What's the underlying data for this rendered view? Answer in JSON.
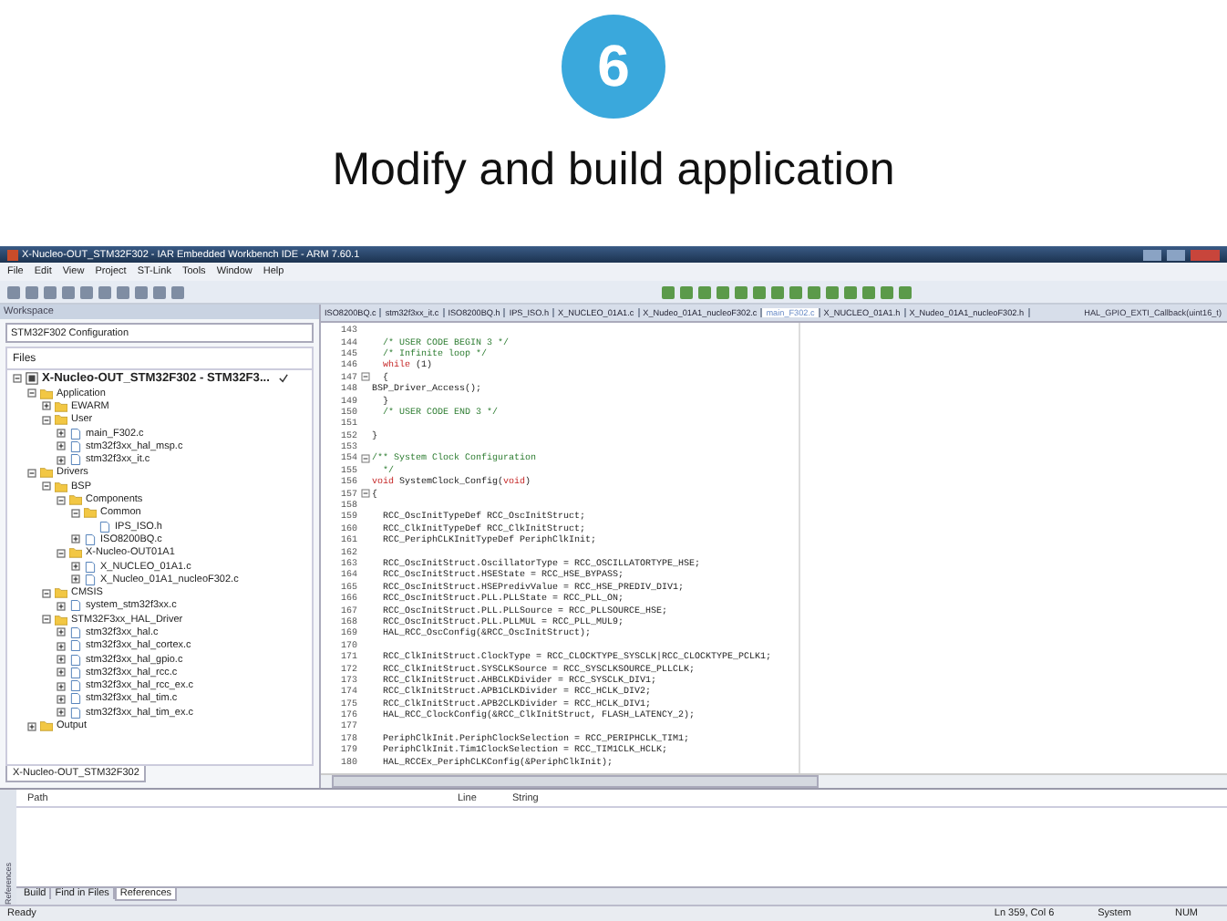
{
  "slide": {
    "step": "6",
    "title": "Modify and build application"
  },
  "window": {
    "title": "X-Nucleo-OUT_STM32F302 - IAR Embedded Workbench IDE - ARM 7.60.1"
  },
  "menu": [
    "File",
    "Edit",
    "View",
    "Project",
    "ST-Link",
    "Tools",
    "Window",
    "Help"
  ],
  "workspace": {
    "title": "Workspace",
    "configuration": "STM32F302 Configuration",
    "files_header": "Files",
    "tree": [
      {
        "label": "X-Nucleo-OUT_STM32F302 - STM32F3...",
        "kind": "project",
        "expanded": true,
        "children": [
          {
            "label": "Application",
            "kind": "folder",
            "expanded": true,
            "children": [
              {
                "label": "EWARM",
                "kind": "folder",
                "expanded": false
              },
              {
                "label": "User",
                "kind": "folder",
                "expanded": true,
                "children": [
                  {
                    "label": "main_F302.c",
                    "kind": "file",
                    "expanded": false
                  },
                  {
                    "label": "stm32f3xx_hal_msp.c",
                    "kind": "file",
                    "expanded": false
                  },
                  {
                    "label": "stm32f3xx_it.c",
                    "kind": "file",
                    "expanded": false
                  }
                ]
              }
            ]
          },
          {
            "label": "Drivers",
            "kind": "folder",
            "expanded": true,
            "children": [
              {
                "label": "BSP",
                "kind": "folder",
                "expanded": true,
                "children": [
                  {
                    "label": "Components",
                    "kind": "folder",
                    "expanded": true,
                    "children": [
                      {
                        "label": "Common",
                        "kind": "folder",
                        "expanded": true,
                        "children": [
                          {
                            "label": "IPS_ISO.h",
                            "kind": "file"
                          }
                        ]
                      },
                      {
                        "label": "ISO8200BQ.c",
                        "kind": "file",
                        "expanded": false
                      }
                    ]
                  },
                  {
                    "label": "X-Nucleo-OUT01A1",
                    "kind": "folder",
                    "expanded": true,
                    "children": [
                      {
                        "label": "X_NUCLEO_01A1.c",
                        "kind": "file",
                        "expanded": false
                      },
                      {
                        "label": "X_Nucleo_01A1_nucleoF302.c",
                        "kind": "file",
                        "expanded": false
                      }
                    ]
                  }
                ]
              },
              {
                "label": "CMSIS",
                "kind": "folder",
                "expanded": true,
                "children": [
                  {
                    "label": "system_stm32f3xx.c",
                    "kind": "file",
                    "expanded": false
                  }
                ]
              },
              {
                "label": "STM32F3xx_HAL_Driver",
                "kind": "folder",
                "expanded": true,
                "children": [
                  {
                    "label": "stm32f3xx_hal.c",
                    "kind": "file",
                    "expanded": false
                  },
                  {
                    "label": "stm32f3xx_hal_cortex.c",
                    "kind": "file",
                    "expanded": false
                  },
                  {
                    "label": "stm32f3xx_hal_gpio.c",
                    "kind": "file",
                    "expanded": false
                  },
                  {
                    "label": "stm32f3xx_hal_rcc.c",
                    "kind": "file",
                    "expanded": false
                  },
                  {
                    "label": "stm32f3xx_hal_rcc_ex.c",
                    "kind": "file",
                    "expanded": false
                  },
                  {
                    "label": "stm32f3xx_hal_tim.c",
                    "kind": "file",
                    "expanded": false
                  },
                  {
                    "label": "stm32f3xx_hal_tim_ex.c",
                    "kind": "file",
                    "expanded": false
                  }
                ]
              }
            ]
          },
          {
            "label": "Output",
            "kind": "folder",
            "expanded": false
          }
        ]
      }
    ],
    "bottom_tab": "X-Nucleo-OUT_STM32F302"
  },
  "editor": {
    "tabs": [
      {
        "label": "ISO8200BQ.c",
        "selected": false
      },
      {
        "label": "stm32f3xx_it.c",
        "selected": false
      },
      {
        "label": "ISO8200BQ.h",
        "selected": false
      },
      {
        "label": "IPS_ISO.h",
        "selected": false
      },
      {
        "label": "X_NUCLEO_01A1.c",
        "selected": false
      },
      {
        "label": "X_Nudeo_01A1_nucleoF302.c",
        "selected": false
      },
      {
        "label": "main_F302.c",
        "selected": true
      },
      {
        "label": "X_NUCLEO_01A1.h",
        "selected": false
      },
      {
        "label": "X_Nudeo_01A1_nucleoF302.h",
        "selected": false
      }
    ],
    "function_selector": "HAL_GPIO_EXTI_Callback(uint16_t)",
    "lines": [
      {
        "num": "143"
      },
      {
        "num": "144",
        "parts": [
          {
            "text": "  /* USER CODE BEGIN 3 */",
            "kind": "comment"
          }
        ]
      },
      {
        "num": "145",
        "parts": [
          {
            "text": "  /* Infinite loop */",
            "kind": "comment"
          }
        ]
      },
      {
        "num": "146",
        "parts": [
          {
            "text": "  while",
            "kind": "keyword"
          },
          {
            "text": " (1)",
            "kind": "plain"
          }
        ]
      },
      {
        "num": "147",
        "fold": true,
        "parts": [
          {
            "text": "  {",
            "kind": "plain"
          }
        ]
      },
      {
        "num": "148",
        "parts": [
          {
            "text": "BSP_Driver_Access();",
            "kind": "plain"
          }
        ]
      },
      {
        "num": "149",
        "parts": [
          {
            "text": "  }",
            "kind": "plain"
          }
        ]
      },
      {
        "num": "150",
        "parts": [
          {
            "text": "  /* USER CODE END 3 */",
            "kind": "comment"
          }
        ]
      },
      {
        "num": "151"
      },
      {
        "num": "152",
        "parts": [
          {
            "text": "}",
            "kind": "plain"
          }
        ]
      },
      {
        "num": "153"
      },
      {
        "num": "154",
        "fold": true,
        "parts": [
          {
            "text": "/** System Clock Configuration",
            "kind": "comment"
          }
        ]
      },
      {
        "num": "155",
        "parts": [
          {
            "text": "  */",
            "kind": "comment"
          }
        ]
      },
      {
        "num": "156",
        "parts": [
          {
            "text": "void",
            "kind": "keyword"
          },
          {
            "text": " SystemClock_Config(",
            "kind": "plain"
          },
          {
            "text": "void",
            "kind": "keyword"
          },
          {
            "text": ")",
            "kind": "plain"
          }
        ]
      },
      {
        "num": "157",
        "fold": true,
        "parts": [
          {
            "text": "{",
            "kind": "plain"
          }
        ]
      },
      {
        "num": "158"
      },
      {
        "num": "159",
        "parts": [
          {
            "text": "  RCC_OscInitTypeDef RCC_OscInitStruct;",
            "kind": "plain"
          }
        ]
      },
      {
        "num": "160",
        "parts": [
          {
            "text": "  RCC_ClkInitTypeDef RCC_ClkInitStruct;",
            "kind": "plain"
          }
        ]
      },
      {
        "num": "161",
        "parts": [
          {
            "text": "  RCC_PeriphCLKInitTypeDef PeriphClkInit;",
            "kind": "plain"
          }
        ]
      },
      {
        "num": "162"
      },
      {
        "num": "163",
        "parts": [
          {
            "text": "  RCC_OscInitStruct.OscillatorType = RCC_OSCILLATORTYPE_HSE;",
            "kind": "plain"
          }
        ]
      },
      {
        "num": "164",
        "parts": [
          {
            "text": "  RCC_OscInitStruct.HSEState = RCC_HSE_BYPASS;",
            "kind": "plain"
          }
        ]
      },
      {
        "num": "165",
        "parts": [
          {
            "text": "  RCC_OscInitStruct.HSEPredivValue = RCC_HSE_PREDIV_DIV1;",
            "kind": "plain"
          }
        ]
      },
      {
        "num": "166",
        "parts": [
          {
            "text": "  RCC_OscInitStruct.PLL.PLLState = RCC_PLL_ON;",
            "kind": "plain"
          }
        ]
      },
      {
        "num": "167",
        "parts": [
          {
            "text": "  RCC_OscInitStruct.PLL.PLLSource = RCC_PLLSOURCE_HSE;",
            "kind": "plain"
          }
        ]
      },
      {
        "num": "168",
        "parts": [
          {
            "text": "  RCC_OscInitStruct.PLL.PLLMUL = RCC_PLL_MUL9;",
            "kind": "plain"
          }
        ]
      },
      {
        "num": "169",
        "parts": [
          {
            "text": "  HAL_RCC_OscConfig(&RCC_OscInitStruct);",
            "kind": "plain"
          }
        ]
      },
      {
        "num": "170"
      },
      {
        "num": "171",
        "parts": [
          {
            "text": "  RCC_ClkInitStruct.ClockType = RCC_CLOCKTYPE_SYSCLK|RCC_CLOCKTYPE_PCLK1;",
            "kind": "plain"
          }
        ]
      },
      {
        "num": "172",
        "parts": [
          {
            "text": "  RCC_ClkInitStruct.SYSCLKSource = RCC_SYSCLKSOURCE_PLLCLK;",
            "kind": "plain"
          }
        ]
      },
      {
        "num": "173",
        "parts": [
          {
            "text": "  RCC_ClkInitStruct.AHBCLKDivider = RCC_SYSCLK_DIV1;",
            "kind": "plain"
          }
        ]
      },
      {
        "num": "174",
        "parts": [
          {
            "text": "  RCC_ClkInitStruct.APB1CLKDivider = RCC_HCLK_DIV2;",
            "kind": "plain"
          }
        ]
      },
      {
        "num": "175",
        "parts": [
          {
            "text": "  RCC_ClkInitStruct.APB2CLKDivider = RCC_HCLK_DIV1;",
            "kind": "plain"
          }
        ]
      },
      {
        "num": "176",
        "parts": [
          {
            "text": "  HAL_RCC_ClockConfig(&RCC_ClkInitStruct, FLASH_LATENCY_2);",
            "kind": "plain"
          }
        ]
      },
      {
        "num": "177"
      },
      {
        "num": "178",
        "parts": [
          {
            "text": "  PeriphClkInit.PeriphClockSelection = RCC_PERIPHCLK_TIM1;",
            "kind": "plain"
          }
        ]
      },
      {
        "num": "179",
        "parts": [
          {
            "text": "  PeriphClkInit.Tim1ClockSelection = RCC_TIM1CLK_HCLK;",
            "kind": "plain"
          }
        ]
      },
      {
        "num": "180",
        "parts": [
          {
            "text": "  HAL_RCCEx_PeriphCLKConfig(&PeriphClkInit);",
            "kind": "plain"
          }
        ]
      }
    ]
  },
  "references": {
    "side_label": "References",
    "columns": [
      "Path",
      "Line",
      "String"
    ],
    "tabs": [
      {
        "label": "Build",
        "selected": false
      },
      {
        "label": "Find in Files",
        "selected": false
      },
      {
        "label": "References",
        "selected": true
      }
    ]
  },
  "status_bar": {
    "message": "Ready",
    "position": "Ln 359, Col 6",
    "encoding": "System",
    "num_lock": "NUM"
  }
}
